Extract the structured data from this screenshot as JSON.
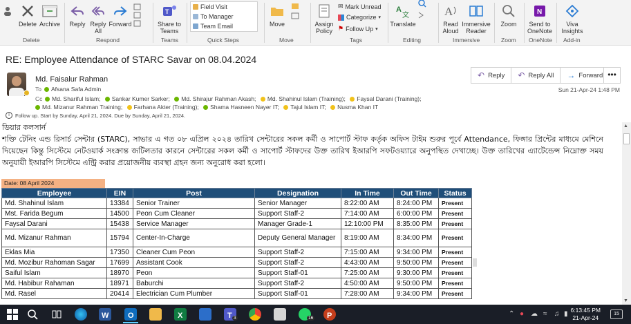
{
  "ribbon": {
    "delete": "Delete",
    "archive": "Archive",
    "reply": "Reply",
    "reply_all_line1": "Reply",
    "reply_all_line2": "All",
    "forward": "Forward",
    "share_line1": "Share to",
    "share_line2": "Teams",
    "quick_steps": [
      "Field Visit",
      "To Manager",
      "Team Email"
    ],
    "move": "Move",
    "assign_line1": "Assign",
    "assign_line2": "Policy",
    "mark_unread": "Mark Unread",
    "categorize": "Categorize",
    "follow_up": "Follow Up",
    "translate": "Translate",
    "read_line1": "Read",
    "read_line2": "Aloud",
    "immersive_line1": "Immersive",
    "immersive_line2": "Reader",
    "zoom": "Zoom",
    "onenote_line1": "Send to",
    "onenote_line2": "OneNote",
    "viva_line1": "Viva",
    "viva_line2": "Insights",
    "groups": {
      "delete": "Delete",
      "respond": "Respond",
      "teams": "Teams",
      "quick_steps": "Quick Steps",
      "move": "Move",
      "tags": "Tags",
      "editing": "Editing",
      "immersive": "Immersive",
      "zoom": "Zoom",
      "onenote": "OneNote",
      "addin": "Add-in"
    }
  },
  "message": {
    "subject": "RE: Employee Attendance of STARC Savar on 08.04.2024",
    "sender": "Md. Faisalur Rahman",
    "to_label": "To",
    "to": "Afsana Safa Admin",
    "cc_label": "Cc",
    "cc": [
      {
        "name": "Md. Shariful Islam;",
        "status": "g"
      },
      {
        "name": "Sankar  Kumer Sarker;",
        "status": "g"
      },
      {
        "name": "Md. Shirajur Rahman Akash;",
        "status": "g"
      },
      {
        "name": "Md. Shahinul Islam (Training);",
        "status": "y"
      },
      {
        "name": "Faysal Darani (Training);",
        "status": "y"
      },
      {
        "name": "Md. Mizanur Rahman Training;",
        "status": "g"
      },
      {
        "name": "Farhana Akter (Training);",
        "status": "y"
      },
      {
        "name": "Shama Hasneen Nayer IT;",
        "status": "g"
      },
      {
        "name": "Tajul Islam IT;",
        "status": "y"
      },
      {
        "name": "Nusma Khan IT",
        "status": "y"
      }
    ],
    "followup": "Follow up.  Start by Sunday, April 21, 2024.  Due by Sunday, April 21, 2024.",
    "date": "Sun 21-Apr-24 1:48 PM",
    "reply": "Reply",
    "reply_all": "Reply All",
    "forward": "Forward",
    "more": "•••"
  },
  "body": {
    "greeting": "ডিয়ার কলসার্ন",
    "paragraph": "শক্তি টেনিং এন্ড রিসার্চ সেন্টার (STARC), সাভার এ গত ০৮ এপ্রিল ২০২৪ তারিখ সেন্টারের সকল কর্মী ও সাপোর্ট স্টাফ কর্তৃক অফিস টাইম শুরুর পূর্বে Attendance, ফিঙ্গার প্রিন্টের মাধ্যমে মেশিনে দিয়েছেন কিন্তু সিস্টেমে নেটওয়ার্ক সংক্রান্ত জটিলতার কারনে সেন্টারের সকল কর্মী ও সাপোর্ট স্টাফদের উক্ত তারিখ ইআরপি সফটওয়্যারে অনুপস্থিত দেখাচ্ছে। উক্ত তারিখের এ্যাটেন্ডেন্স নিম্নোক্ত সময় অনুযায়ী ইআরপি সিস্টেমে এন্ট্রি করার প্রয়োজনীয় ব্যবস্থা গ্রহন জন্য অনুরোধ করা হলো।",
    "date_label": "Date: 08 April 2024"
  },
  "table": {
    "headers": [
      "Employee",
      "EIN",
      "Post",
      "Designation",
      "In Time",
      "Out Time",
      "Status"
    ],
    "rows": [
      [
        "Md. Shahinul Islam",
        "13384",
        "Senior Trainer",
        "Senior Manager",
        "8:22:00 AM",
        "8:24:00 PM",
        "Present"
      ],
      [
        "Mst. Farida Begum",
        "14500",
        "Peon Cum Cleaner",
        "Support Staff-2",
        "7:14:00 AM",
        "6:00:00 PM",
        "Present"
      ],
      [
        "Faysal Darani",
        "15438",
        "Service Manager",
        "Manager Grade-1",
        "12:10:00 PM",
        "8:35:00 PM",
        "Present"
      ],
      [
        "Md. Mizanur Rahman",
        "15794",
        "Center-In-Charge",
        "Deputy General Manager",
        "8:19:00 AM",
        "8:34:00 PM",
        "Present"
      ],
      [
        "Eklas Mia",
        "17350",
        "Cleaner Cum Peon",
        "Support Staff-2",
        "7:15:00 AM",
        "9:34:00 PM",
        "Present"
      ],
      [
        "Md. Mozibur Rahoman Sagar",
        "17699",
        "Assistant Cook",
        "Support Staff-2",
        "4:43:00 AM",
        "9:50:00 PM",
        "Present"
      ],
      [
        "Saiful Islam",
        "18970",
        "Peon",
        "Support Staff-01",
        "7:25:00 AM",
        "9:30:00 PM",
        "Present"
      ],
      [
        "Md. Habibur Rahaman",
        "18971",
        "Baburchi",
        "Support Staff-2",
        "4:50:00 AM",
        "9:50:00 PM",
        "Present"
      ],
      [
        "Md. Rasel",
        "20414",
        "Electrician Cum Plumber",
        "Support Staff-01",
        "7:28:00 AM",
        "9:34:00 PM",
        "Present"
      ]
    ]
  },
  "taskbar": {
    "time": "6:13:45 PM",
    "date": "21-Apr-24",
    "whatsapp_badge": "16",
    "teams_badge": "3",
    "notif": "15"
  }
}
